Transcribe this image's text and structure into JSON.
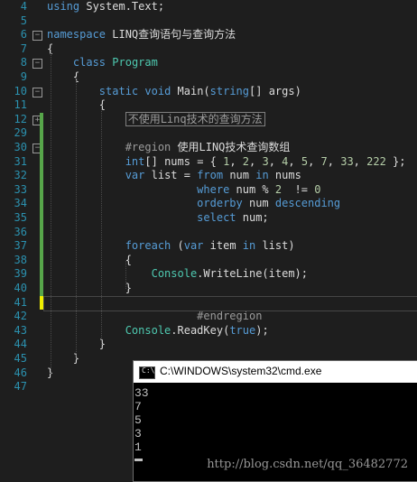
{
  "editor": {
    "lines": [
      {
        "n": "4",
        "html": "<span class=\"kw\">using</span> System.Text;"
      },
      {
        "n": "5",
        "html": ""
      },
      {
        "n": "6",
        "html": "<span class=\"kw\">namespace</span> LINQ查询语句与查询方法"
      },
      {
        "n": "7",
        "html": "{"
      },
      {
        "n": "8",
        "html": "    <span class=\"kw\">class</span> <span class=\"ty\">Program</span>"
      },
      {
        "n": "9",
        "html": "    {"
      },
      {
        "n": "10",
        "html": "        <span class=\"kw\">static</span> <span class=\"kw\">void</span> Main(<span class=\"kw\">string</span>[] args)"
      },
      {
        "n": "11",
        "html": "        {"
      },
      {
        "n": "12",
        "html": "            <span class=\"collapsed-text\">不使用Linq技术的查询方法</span>"
      },
      {
        "n": "29",
        "html": ""
      },
      {
        "n": "30",
        "html": "            <span class=\"rg\">#region</span> 使用LINQ技术查询数组"
      },
      {
        "n": "31",
        "html": "            <span class=\"kw\">int</span>[] nums = { <span class=\"num\">1</span>, <span class=\"num\">2</span>, <span class=\"num\">3</span>, <span class=\"num\">4</span>, <span class=\"num\">5</span>, <span class=\"num\">7</span>, <span class=\"num\">33</span>, <span class=\"num\">222</span> };"
      },
      {
        "n": "32",
        "html": "            <span class=\"kw\">var</span> list = <span class=\"kw\">from</span> num <span class=\"kw\">in</span> nums"
      },
      {
        "n": "33",
        "html": "                       <span class=\"kw\">where</span> num % <span class=\"num\">2</span>  != <span class=\"num\">0</span>"
      },
      {
        "n": "34",
        "html": "                       <span class=\"kw\">orderby</span> num <span class=\"kw\">descending</span>"
      },
      {
        "n": "35",
        "html": "                       <span class=\"kw\">select</span> num;"
      },
      {
        "n": "36",
        "html": ""
      },
      {
        "n": "37",
        "html": "            <span class=\"kw\">foreach</span> (<span class=\"kw\">var</span> item <span class=\"kw\">in</span> list)"
      },
      {
        "n": "38",
        "html": "            {"
      },
      {
        "n": "39",
        "html": "                <span class=\"ty\">Console</span>.WriteLine(item);"
      },
      {
        "n": "40",
        "html": "            }"
      },
      {
        "n": "41",
        "html": ""
      },
      {
        "n": "42",
        "html": "                       <span class=\"rg\">#endregion</span>"
      },
      {
        "n": "43",
        "html": "            <span class=\"ty\">Console</span>.ReadKey(<span class=\"kw\">true</span>);"
      },
      {
        "n": "44",
        "html": "        }"
      },
      {
        "n": "45",
        "html": "    }"
      },
      {
        "n": "46",
        "html": "}"
      },
      {
        "n": "47",
        "html": ""
      }
    ]
  },
  "cmd": {
    "title": "C:\\WINDOWS\\system32\\cmd.exe",
    "icon_label": "C:\\",
    "output": [
      "33",
      "7",
      "5",
      "3",
      "1"
    ]
  },
  "watermark": "http://blog.csdn.net/qq_36482772",
  "colors": {
    "keyword": "#569cd6",
    "type": "#4ec9b0",
    "number": "#b5cea8",
    "line_number": "#2b91af",
    "change_bar": "#57a64a"
  }
}
